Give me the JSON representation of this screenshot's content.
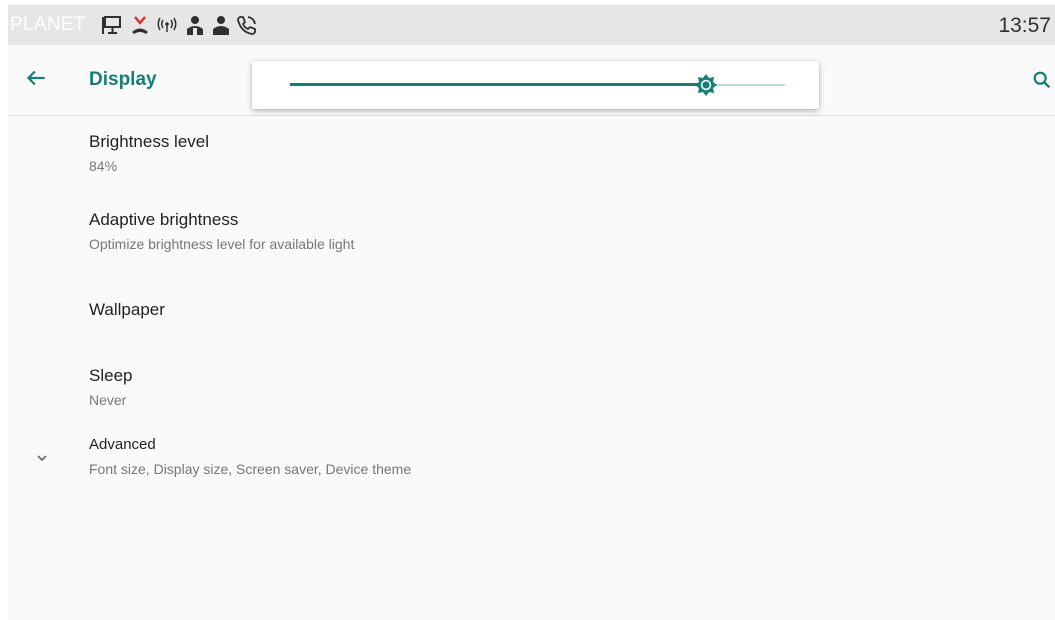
{
  "status_bar": {
    "brand": "PLANET",
    "time": "13:57",
    "icons": [
      "screen-icon",
      "missed-call-icon",
      "wireless-signal-icon",
      "contact-person-icon",
      "contact-person-icon",
      "phone-icon"
    ]
  },
  "app_bar": {
    "title": "Display",
    "back_icon": "arrow-back-icon",
    "search_icon": "search-icon"
  },
  "brightness_popup": {
    "level": 0.84,
    "icon": "brightness-icon"
  },
  "settings": [
    {
      "title": "Brightness level",
      "summary": "84%"
    },
    {
      "title": "Adaptive brightness",
      "summary": "Optimize brightness level for available light"
    },
    {
      "title": "Wallpaper",
      "summary": ""
    },
    {
      "title": "Sleep",
      "summary": "Never"
    },
    {
      "title": "Advanced",
      "summary": "Font size, Display size, Screen saver, Device theme",
      "icon": "chevron-down-icon"
    }
  ],
  "colors": {
    "accent": "#147f72",
    "accent_light": "#b5dcd6",
    "status_bar_bg": "#e6e6e6",
    "background": "#fafafa"
  }
}
